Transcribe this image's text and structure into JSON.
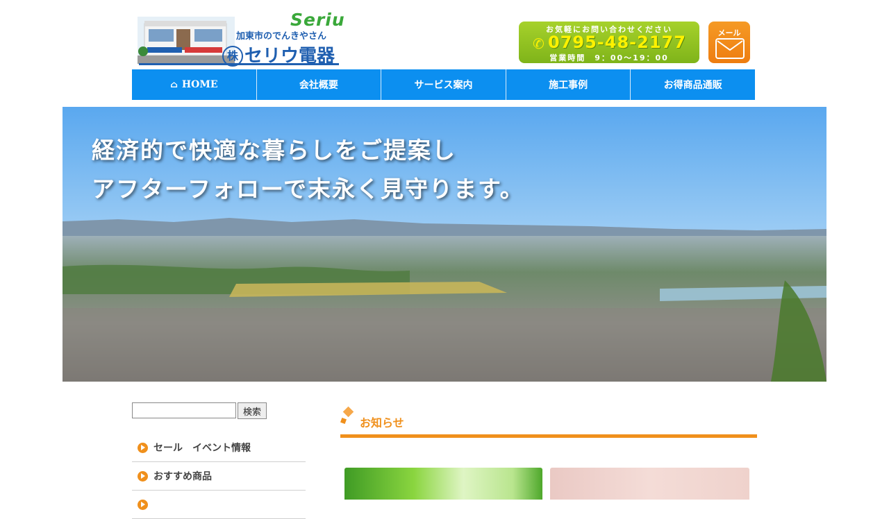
{
  "header": {
    "logo_brand": "Seriu",
    "logo_tagline": "加東市のでんきやさん",
    "logo_kabu": "株",
    "logo_company": "セリウ電器",
    "phone_prompt": "お気軽にお問い合わせください",
    "phone_number": "0795-48-2177",
    "phone_hours": "営業時間　9：00～19：00",
    "mail_label": "メール"
  },
  "nav": {
    "items": [
      {
        "label": "HOME",
        "icon": "home-icon"
      },
      {
        "label": "会社概要"
      },
      {
        "label": "サービス案内"
      },
      {
        "label": "施工事例"
      },
      {
        "label": "お得商品通販"
      }
    ]
  },
  "hero": {
    "line1": "経済的で快適な暮らしをご提案し",
    "line2": "アフターフォローで末永く見守ります。"
  },
  "sidebar": {
    "search_placeholder": "",
    "search_button": "検索",
    "items": [
      {
        "label": "セール　イベント情報"
      },
      {
        "label": "おすすめ商品"
      },
      {
        "label": ""
      }
    ]
  },
  "main": {
    "news_title": "お知らせ"
  },
  "colors": {
    "nav_blue": "#0c8ff0",
    "accent_orange": "#f0901c",
    "phone_green": "#8bc21f",
    "logo_blue": "#1f5fb0"
  }
}
